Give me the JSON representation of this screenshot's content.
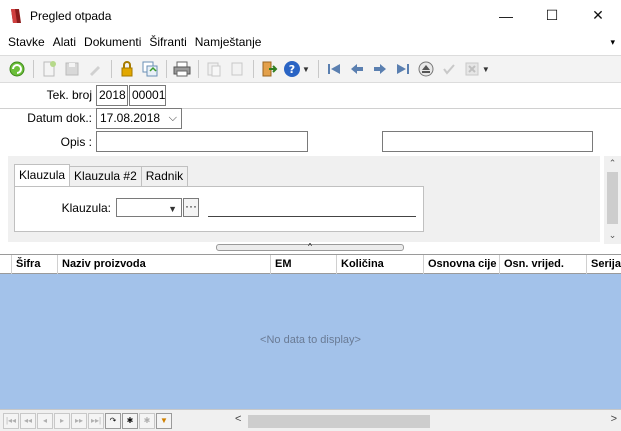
{
  "window": {
    "title": "Pregled otpada",
    "minimize": "—",
    "maximize": "☐",
    "close": "✕"
  },
  "menu": [
    "Stavke",
    "Alati",
    "Dokumenti",
    "Šifranti",
    "Namještanje"
  ],
  "menu_more": "▾",
  "toolbar": {
    "icons": [
      "refresh-icon",
      "new-document-icon",
      "save-icon",
      "edit-icon",
      "lock-icon",
      "copy-icon",
      "print-icon",
      "export-icon",
      "paste-icon",
      "exit-icon",
      "help-icon",
      "first-record-icon",
      "previous-record-icon",
      "next-record-icon",
      "last-record-icon",
      "up-icon",
      "confirm-icon",
      "cancel-icon"
    ]
  },
  "form": {
    "tek_broj_label": "Tek. broj",
    "tek_broj_year": "2018",
    "tek_broj_number": "00001",
    "datum_label": "Datum dok.:",
    "datum_value": "17.08.2018",
    "opis_label": "Opis :",
    "opis_value": "",
    "opis_value2": ""
  },
  "tabs": [
    "Klauzula",
    "Klauzula #2",
    "Radnik"
  ],
  "klauzula": {
    "label": "Klauzula:",
    "value": "",
    "browse": "···",
    "description": ""
  },
  "grid": {
    "columns": [
      "Šifra",
      "Naziv proizvoda",
      "EM",
      "Količina",
      "Osnovna cije",
      "Osn. vrijed.",
      "Serija"
    ],
    "empty_text": "<No data to display>"
  },
  "grid_nav": [
    "|◂◂",
    "◂◂",
    "◂",
    "▸",
    "▸▸",
    "▸▸|",
    "↷",
    "✱",
    "✱",
    "▼"
  ]
}
